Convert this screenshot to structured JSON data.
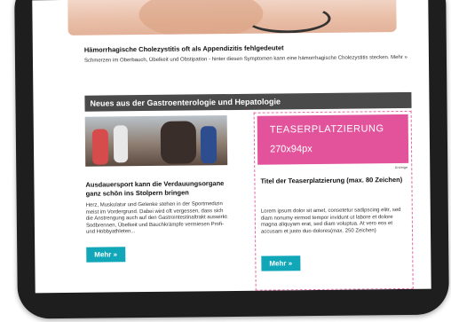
{
  "hero": {
    "title": "Hämorrhagische Cholezystitis oft als Appendizitis fehlgedeutet",
    "text": "Schmerzen im Oberbauch, Übelkeit und Obstipation - hinter diesen Symptomen kann eine hämorrhagische Cholezystitis stecken. Mehr »"
  },
  "section": {
    "heading": "Neues aus der Gastroenterologie und Hepatologie"
  },
  "article_left": {
    "title": "Ausdauersport kann die Verdauungsorgane ganz schön ins Stolpern bringen",
    "text": "Herz, Muskulatur und Gelenke stehen in der Sportmedizin meist im Vordergrund. Dabei wird oft vergessen, dass sich die Anstrengung auch auf den Gastrointestinaltrakt auswirkt: Sodbrennen, Übelkeit und Bauchkrämpfe vermiesen Profi- und Hobbyathleten...",
    "button": "Mehr »"
  },
  "teaser": {
    "line1": "TEASERPLATZIERUNG",
    "line2": "270x94px",
    "ad_label": "Anzeige",
    "title": "Titel der Teaserplatzierung (max. 80 Zeichen)",
    "text": "Lorem ipsum dolor sit amet, consetetur sadipscing elitr, sed diam nonumy eirmod tempor invidunt ut labore et dolore magna aliquyam erat, sed diam voluptua. At vero eos et accusam et justo duo dolores(max. 250 Zeichen)",
    "button": "Mehr »",
    "accent_color": "#e2539b"
  },
  "colors": {
    "button": "#11a7b8",
    "section_bar": "#4a4a4a"
  }
}
